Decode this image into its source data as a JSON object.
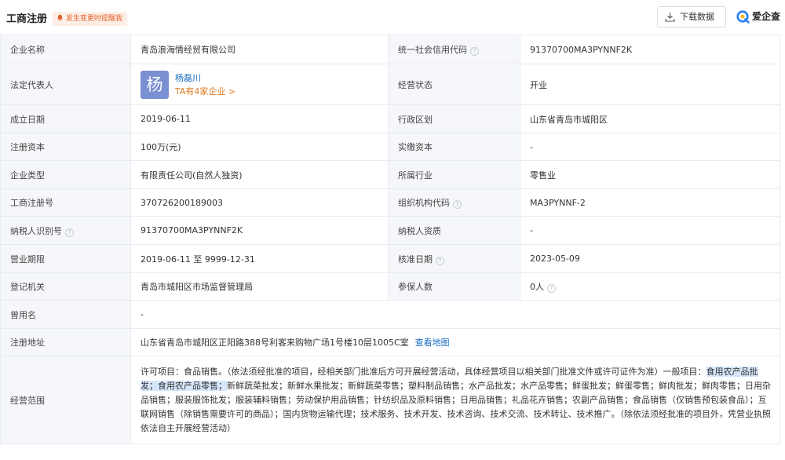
{
  "header": {
    "title": "工商注册",
    "remind": "发生变更时提醒我",
    "download": "下载数据",
    "logo": "爱企查"
  },
  "rows": [
    {
      "l1": "企业名称",
      "v1": "青岛浪海情经贸有限公司",
      "l2": "统一社会信用代码",
      "v2": "91370700MA3PYNNF2K"
    },
    {
      "l1": "法定代表人",
      "rep_avatar": "杨",
      "rep_name": "杨磊川",
      "rep_count": "TA有4家企业 >",
      "l2": "经营状态",
      "v2": "开业"
    },
    {
      "l1": "成立日期",
      "v1": "2019-06-11",
      "l2": "行政区划",
      "v2": "山东省青岛市城阳区"
    },
    {
      "l1": "注册资本",
      "v1": "100万(元)",
      "l2": "实缴资本",
      "v2": "-"
    },
    {
      "l1": "企业类型",
      "v1": "有限责任公司(自然人独资)",
      "l2": "所属行业",
      "v2": "零售业"
    },
    {
      "l1": "工商注册号",
      "v1": "370726200189003",
      "l2": "组织机构代码",
      "v2": "MA3PYNNF-2"
    },
    {
      "l1": "纳税人识别号",
      "v1": "91370700MA3PYNNF2K",
      "l2": "纳税人资质",
      "v2": "-"
    },
    {
      "l1": "营业期限",
      "v1": "2019-06-11 至 9999-12-31",
      "l2": "核准日期",
      "v2": "2023-05-09"
    },
    {
      "l1": "登记机关",
      "v1": "青岛市城阳区市场监督管理局",
      "l2": "参保人数",
      "v2": "0人"
    },
    {
      "l1": "曾用名",
      "v1": "-"
    },
    {
      "l1": "注册地址",
      "v1": "山东省青岛市城阳区正阳路388号利客来购物广场1号楼10层1005C室",
      "link": "查看地图"
    },
    {
      "l1": "经营范围",
      "scope_a": "许可项目：食品销售。（依法须经批准的项目，经相关部门批准后方可开展经营活动，具体经营项目以相关部门批准文件或许可证件为准）一般项目：",
      "scope_hl": "食用农产品批发；食用农产品零售；",
      "scope_b": "新鲜蔬菜批发；新鲜水果批发；新鲜蔬菜零售；塑料制品销售；水产品批发；水产品零售；鲜蛋批发；鲜蛋零售；鲜肉批发；鲜肉零售；日用杂品销售；服装服饰批发；服装辅料销售；劳动保护用品销售；针纺织品及原料销售；日用品销售；礼品花卉销售；农副产品销售；食品销售（仅销售预包装食品）；互联网销售（除销售需要许可的商品）；国内货物运输代理；技术服务、技术开发、技术咨询、技术交流、技术转让、技术推广。（除依法须经批准的项目外，凭营业执照依法自主开展经营活动）"
    }
  ],
  "help_glyph": "?",
  "colors": {
    "accent": "#1a6ec2",
    "orange": "#e07b22",
    "label_bg": "#f5f7fa",
    "highlight": "#d6e6fb"
  }
}
